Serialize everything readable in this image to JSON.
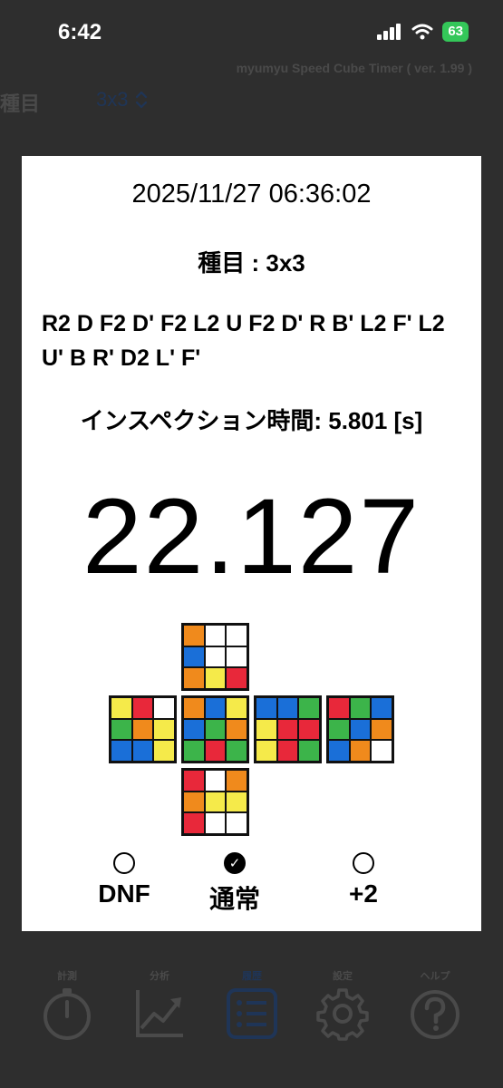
{
  "status": {
    "time": "6:42",
    "battery": "63"
  },
  "app_title": "myumyu Speed Cube Timer ( ver. 1.99 )",
  "event_label": "種目",
  "event_value": "3x3",
  "card": {
    "datetime": "2025/11/27 06:36:02",
    "event_line": "種目 : 3x3",
    "scramble": "R2 D F2 D' F2 L2 U F2 D' R B' L2 F' L2 U' B R' D2 L' F'",
    "inspection": "インスペクション時間: 5.801 [s]",
    "time": "22.127"
  },
  "cube_net": {
    "U": [
      "#f08a1c",
      "#ffffff",
      "#ffffff",
      "#1a6fd8",
      "#ffffff",
      "#ffffff",
      "#f08a1c",
      "#f5ea4a",
      "#e8283a"
    ],
    "L": [
      "#f5ea4a",
      "#e8283a",
      "#ffffff",
      "#3cb44a",
      "#f08a1c",
      "#f5ea4a",
      "#1a6fd8",
      "#1a6fd8",
      "#f5ea4a"
    ],
    "F": [
      "#f08a1c",
      "#1a6fd8",
      "#f5ea4a",
      "#1a6fd8",
      "#3cb44a",
      "#f08a1c",
      "#3cb44a",
      "#e8283a",
      "#3cb44a"
    ],
    "R": [
      "#1a6fd8",
      "#1a6fd8",
      "#3cb44a",
      "#f5ea4a",
      "#e8283a",
      "#e8283a",
      "#f5ea4a",
      "#e8283a",
      "#3cb44a"
    ],
    "B": [
      "#e8283a",
      "#3cb44a",
      "#1a6fd8",
      "#3cb44a",
      "#1a6fd8",
      "#f08a1c",
      "#1a6fd8",
      "#f08a1c",
      "#ffffff"
    ],
    "D": [
      "#e8283a",
      "#ffffff",
      "#f08a1c",
      "#f08a1c",
      "#f5ea4a",
      "#f5ea4a",
      "#e8283a",
      "#ffffff",
      "#ffffff"
    ]
  },
  "penalty": {
    "options": [
      {
        "label": "DNF",
        "checked": false
      },
      {
        "label": "通常",
        "checked": true
      },
      {
        "label": "+2",
        "checked": false
      }
    ],
    "check_glyph": "✓"
  },
  "tabs": [
    {
      "label": "計測",
      "icon": "stopwatch-icon"
    },
    {
      "label": "分析",
      "icon": "chart-icon"
    },
    {
      "label": "履歴",
      "icon": "list-icon",
      "active": true
    },
    {
      "label": "設定",
      "icon": "gear-icon"
    },
    {
      "label": "ヘルプ",
      "icon": "help-icon"
    }
  ],
  "colors": {
    "accent": "#1f3557",
    "overlay": "#2e2e2e",
    "battery": "#34c759"
  }
}
